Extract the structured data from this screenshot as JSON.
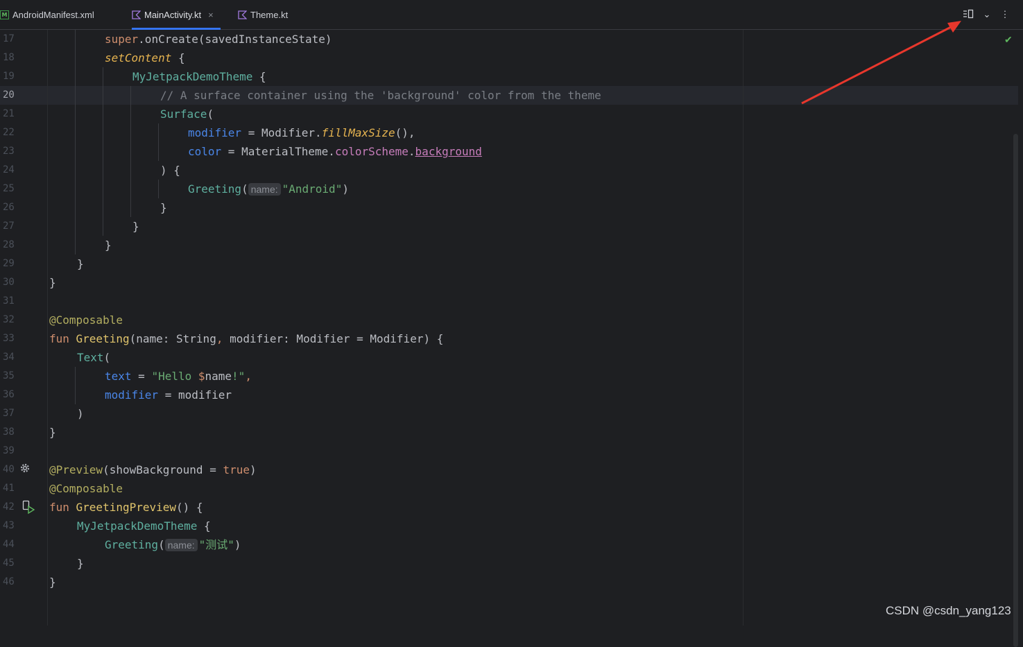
{
  "tabs": [
    {
      "label": "AndroidManifest.xml",
      "icon": "xml-file-icon",
      "active": false
    },
    {
      "label": "MainActivity.kt",
      "icon": "kotlin-file-icon",
      "active": true,
      "close": "×"
    },
    {
      "label": "Theme.kt",
      "icon": "kotlin-file-icon",
      "active": false
    }
  ],
  "toolbar": {
    "split_mode": "≡⎕",
    "dropdown": "⌄",
    "more": "⋮"
  },
  "editor": {
    "current_line": 20,
    "line_numbers": [
      "17",
      "18",
      "19",
      "20",
      "21",
      "22",
      "23",
      "24",
      "25",
      "26",
      "27",
      "28",
      "29",
      "30",
      "31",
      "32",
      "33",
      "34",
      "35",
      "36",
      "37",
      "38",
      "39",
      "40",
      "41",
      "42",
      "43",
      "44",
      "45",
      "46"
    ],
    "code": {
      "l17": {
        "a": "super",
        "b": ".onCreate(savedInstanceState)"
      },
      "l18": {
        "a": "setContent",
        "b": " {"
      },
      "l19": {
        "a": "MyJetpackDemoTheme",
        "b": " {"
      },
      "l20": {
        "a": "// A surface container using the 'background' color from the theme"
      },
      "l21": {
        "a": "Surface",
        "b": "("
      },
      "l22": {
        "a": "modifier",
        "b": " = ",
        "c": "Modifier.",
        "d": "fillMaxSize",
        "e": "(),"
      },
      "l23": {
        "a": "color",
        "b": " = ",
        "c": "MaterialTheme.",
        "d": "colorScheme",
        "e": ".",
        "f": "background"
      },
      "l24": {
        "a": ") {"
      },
      "l25": {
        "a": "Greeting",
        "b": "(",
        "hint": "name:",
        "c": "\"Android\"",
        "d": ")"
      },
      "l26": {
        "a": "}"
      },
      "l27": {
        "a": "}"
      },
      "l28": {
        "a": "}"
      },
      "l29": {
        "a": "}"
      },
      "l30": {
        "a": "}"
      },
      "l32": {
        "a": "@Composable"
      },
      "l33": {
        "a": "fun ",
        "b": "Greeting",
        "c": "(name: String",
        "d": ",",
        "e": " modifier: Modifier = Modifier) {"
      },
      "l34": {
        "a": "Text",
        "b": "("
      },
      "l35": {
        "a": "text",
        "b": " = ",
        "c": "\"Hello ",
        "d": "$",
        "e": "name",
        "f": "!\"",
        "g": ","
      },
      "l36": {
        "a": "modifier",
        "b": " = ",
        "c": "modifier"
      },
      "l37": {
        "a": ")"
      },
      "l38": {
        "a": "}"
      },
      "l40": {
        "a": "@Preview",
        "b": "(showBackground = ",
        "c": "true",
        "d": ")"
      },
      "l41": {
        "a": "@Composable"
      },
      "l42": {
        "a": "fun ",
        "b": "GreetingPreview",
        "c": "() {"
      },
      "l43": {
        "a": "MyJetpackDemoTheme",
        "b": " {"
      },
      "l44": {
        "a": "Greeting",
        "b": "(",
        "hint": "name:",
        "c": "\"测试\"",
        "d": ")"
      },
      "l45": {
        "a": "}"
      },
      "l46": {
        "a": "}"
      }
    },
    "inspection_status": "✔"
  },
  "watermark": "CSDN @csdn_yang123",
  "colors": {
    "accent": "#3574f0",
    "annotation_arrow": "#e8372c",
    "background": "#1e1f22"
  }
}
